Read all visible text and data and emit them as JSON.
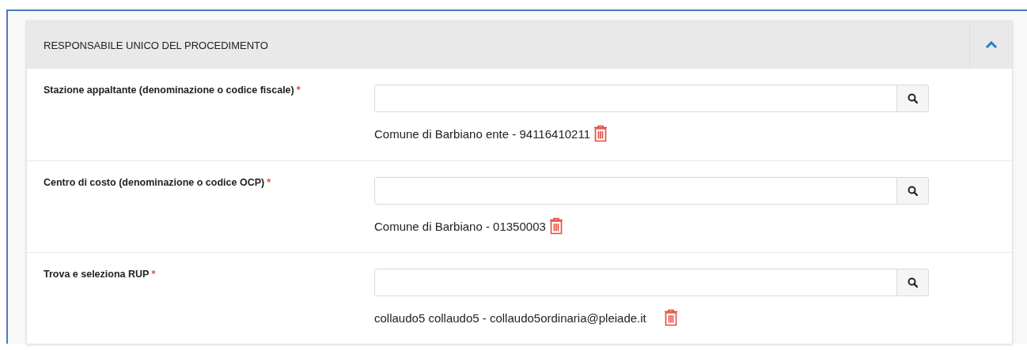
{
  "panel": {
    "title": "RESPONSABILE UNICO DEL PROCEDIMENTO",
    "expanded": true,
    "fields": [
      {
        "label": "Stazione appaltante (denominazione o codice fiscale)",
        "required_mark": "*",
        "selected_value": "Comune di Barbiano ente - 94116410211"
      },
      {
        "label": "Centro di costo (denominazione o codice OCP)",
        "required_mark": "*",
        "selected_value": "Comune di Barbiano - 01350003"
      },
      {
        "label": "Trova e seleziona RUP",
        "required_mark": "*",
        "selected_value": "collaudo5 collaudo5 - collaudo5ordinaria@pleiade.it"
      }
    ]
  }
}
